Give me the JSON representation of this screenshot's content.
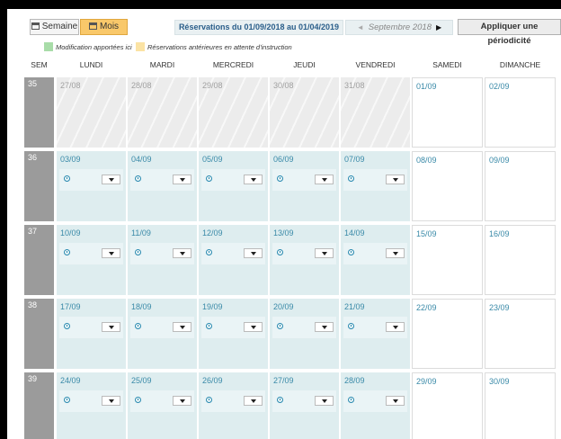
{
  "toolbar": {
    "week_label": "Semaine",
    "month_label": "Mois",
    "range_label": "Réservations du 01/09/2018 au 01/04/2019",
    "prev_arrow": "◄",
    "current_month": "Septembre 2018",
    "next_arrow": "▶",
    "apply_label": "Appliquer une périodicité"
  },
  "legend": [
    {
      "label": "Modification apportées ici",
      "color": "#a8dca8"
    },
    {
      "label": "Réservations antérieures en attente d'instruction",
      "color": "#fbe3a4"
    }
  ],
  "headers": [
    "SEM",
    "LUNDI",
    "MARDI",
    "MERCREDI",
    "JEUDI",
    "VENDREDI",
    "SAMEDI",
    "DIMANCHE"
  ],
  "weeks": [
    {
      "num": "35",
      "days": [
        {
          "date": "27/08",
          "kind": "past"
        },
        {
          "date": "28/08",
          "kind": "past"
        },
        {
          "date": "29/08",
          "kind": "past"
        },
        {
          "date": "30/08",
          "kind": "past"
        },
        {
          "date": "31/08",
          "kind": "past"
        },
        {
          "date": "01/09",
          "kind": "weekend"
        },
        {
          "date": "02/09",
          "kind": "weekend"
        }
      ]
    },
    {
      "num": "36",
      "days": [
        {
          "date": "03/09",
          "kind": "work"
        },
        {
          "date": "04/09",
          "kind": "work"
        },
        {
          "date": "05/09",
          "kind": "work"
        },
        {
          "date": "06/09",
          "kind": "work"
        },
        {
          "date": "07/09",
          "kind": "work"
        },
        {
          "date": "08/09",
          "kind": "weekend"
        },
        {
          "date": "09/09",
          "kind": "weekend"
        }
      ]
    },
    {
      "num": "37",
      "days": [
        {
          "date": "10/09",
          "kind": "work"
        },
        {
          "date": "11/09",
          "kind": "work"
        },
        {
          "date": "12/09",
          "kind": "work"
        },
        {
          "date": "13/09",
          "kind": "work"
        },
        {
          "date": "14/09",
          "kind": "work"
        },
        {
          "date": "15/09",
          "kind": "weekend"
        },
        {
          "date": "16/09",
          "kind": "weekend"
        }
      ]
    },
    {
      "num": "38",
      "days": [
        {
          "date": "17/09",
          "kind": "work"
        },
        {
          "date": "18/09",
          "kind": "work"
        },
        {
          "date": "19/09",
          "kind": "work"
        },
        {
          "date": "20/09",
          "kind": "work"
        },
        {
          "date": "21/09",
          "kind": "work"
        },
        {
          "date": "22/09",
          "kind": "weekend"
        },
        {
          "date": "23/09",
          "kind": "weekend"
        }
      ]
    },
    {
      "num": "39",
      "days": [
        {
          "date": "24/09",
          "kind": "work"
        },
        {
          "date": "25/09",
          "kind": "work"
        },
        {
          "date": "26/09",
          "kind": "work"
        },
        {
          "date": "27/09",
          "kind": "work"
        },
        {
          "date": "28/09",
          "kind": "work"
        },
        {
          "date": "29/09",
          "kind": "weekend"
        },
        {
          "date": "30/09",
          "kind": "weekend"
        }
      ]
    }
  ]
}
